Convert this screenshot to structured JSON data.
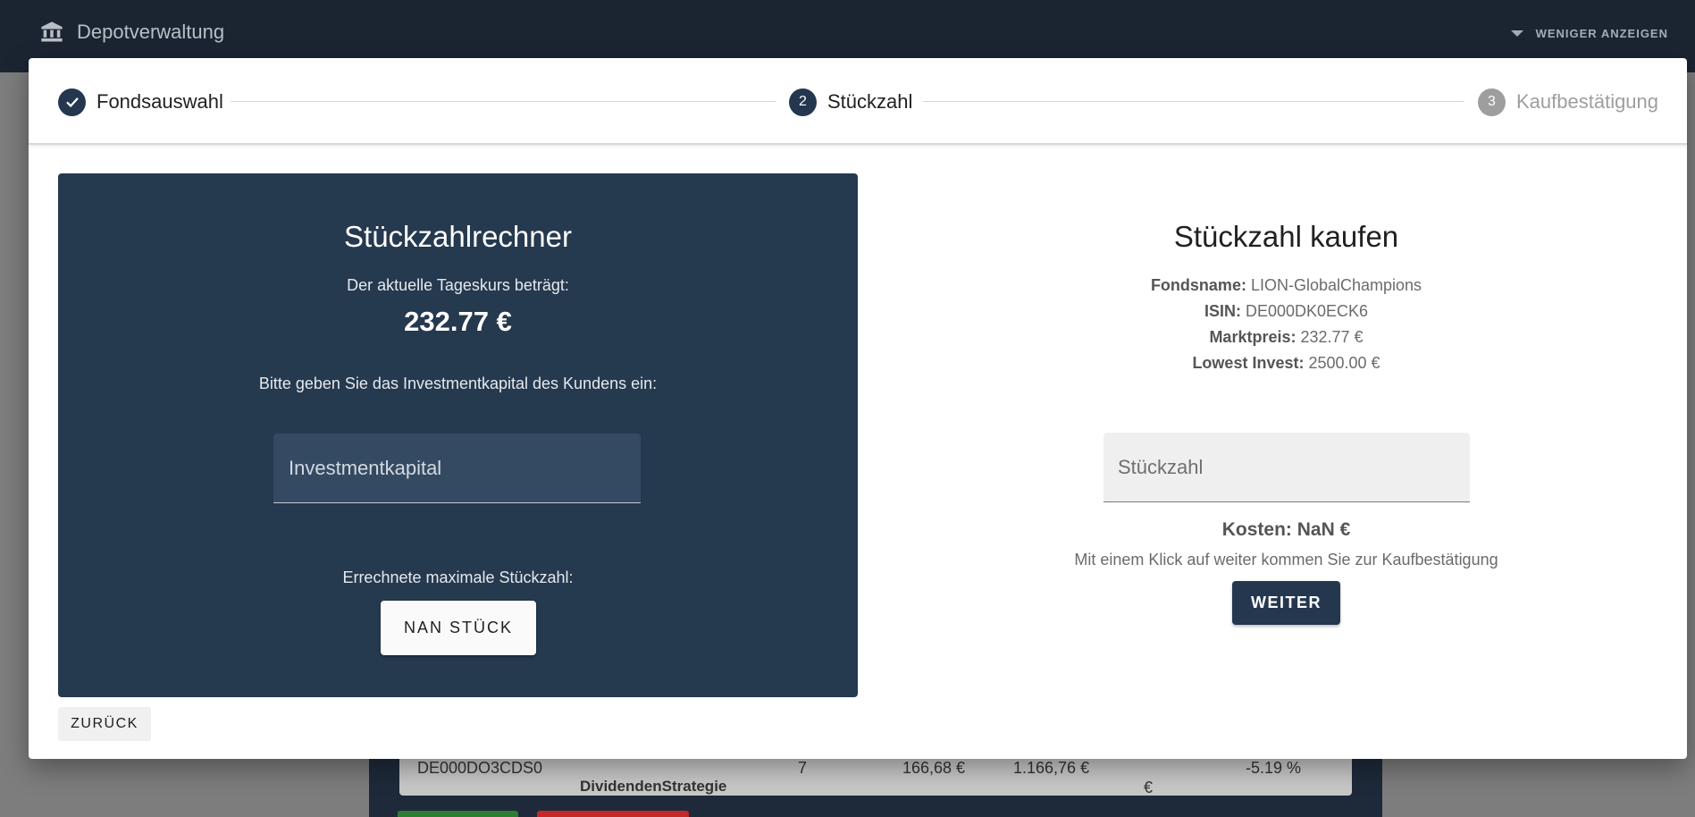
{
  "app": {
    "title": "Depotverwaltung",
    "less_label": "WENIGER ANZEIGEN"
  },
  "background_table": {
    "row": {
      "isin": "DE000DO3CDS0",
      "name": "DividendenStrategie",
      "count": "7",
      "price": "166,68 €",
      "value": "1.166,76 €",
      "partial": "€",
      "change": "-5.19 %"
    }
  },
  "stepper": {
    "steps": [
      {
        "number": "✓",
        "label": "Fondsauswahl",
        "state": "done"
      },
      {
        "number": "2",
        "label": "Stückzahl",
        "state": "active"
      },
      {
        "number": "3",
        "label": "Kaufbestätigung",
        "state": "pending"
      }
    ]
  },
  "calculator": {
    "title": "Stückzahlrechner",
    "rate_label": "Der aktuelle Tageskurs beträgt:",
    "rate_value": "232.77 €",
    "capital_prompt": "Bitte geben Sie das Investmentkapital des Kundens ein:",
    "capital_placeholder": "Investmentkapital",
    "result_label": "Errechnete maximale Stückzahl:",
    "result_button": "NAN STÜCK"
  },
  "purchase": {
    "title": "Stückzahl kaufen",
    "fondsname_label": "Fondsname:",
    "fondsname_value": "LION-GlobalChampions",
    "isin_label": "ISIN:",
    "isin_value": "DE000DK0ECK6",
    "marktpreis_label": "Marktpreis:",
    "marktpreis_value": "232.77 €",
    "lowest_label": "Lowest Invest:",
    "lowest_value": "2500.00 €",
    "quantity_placeholder": "Stückzahl",
    "cost_text": "Kosten: NaN €",
    "hint": "Mit einem Klick auf weiter kommen Sie zur Kaufbestätigung",
    "next_button": "WEITER"
  },
  "back_button": "ZURÜCK",
  "colors": {
    "primary": "#24374f",
    "app_bar": "#1b2532",
    "inactive_step": "#9e9e9e"
  }
}
